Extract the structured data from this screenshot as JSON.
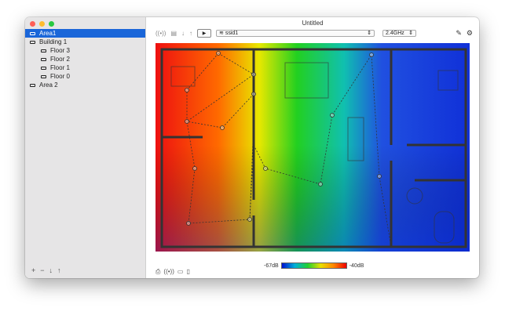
{
  "window": {
    "title": "Untitled"
  },
  "sidebar": {
    "items": [
      {
        "label": "Area1",
        "level": 0,
        "selected": true
      },
      {
        "label": "Building 1",
        "level": 0,
        "selected": false
      },
      {
        "label": "Floor 3",
        "level": 1,
        "selected": false
      },
      {
        "label": "Floor 2",
        "level": 1,
        "selected": false
      },
      {
        "label": "Floor 1",
        "level": 1,
        "selected": false
      },
      {
        "label": "Floor 0",
        "level": 1,
        "selected": false
      },
      {
        "label": "Area 2",
        "level": 0,
        "selected": false
      }
    ],
    "bottom_buttons": [
      "+",
      "−",
      "↓",
      "↑"
    ]
  },
  "toolbar": {
    "ssid_value": "ssid1",
    "band_value": "2.4GHz",
    "play_icon": "▶"
  },
  "heatmap": {
    "scale_min_label": "-67dB",
    "scale_max_label": "-40dB"
  },
  "colors": {
    "accent": "#1a66d9"
  }
}
